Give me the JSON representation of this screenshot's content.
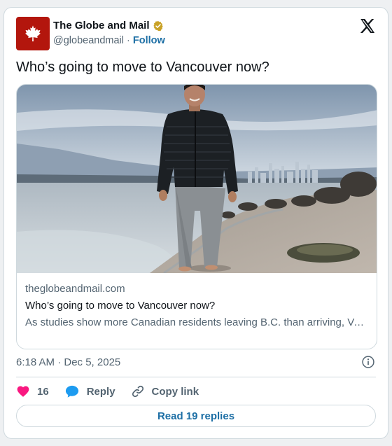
{
  "account": {
    "name": "The Globe and Mail",
    "handle": "@globeandmail",
    "separator": "·",
    "follow_label": "Follow",
    "avatar_icon": "maple-leaf-icon",
    "brand_color": "#b3160d",
    "verified_color": "#c9a227"
  },
  "tweet": {
    "text": "Who’s going to move to Vancouver now?",
    "timestamp": "6:18 AM · Dec 5, 2025"
  },
  "link_card": {
    "image_icon": "photo-man-walking-on-beach",
    "domain": "theglobeandmail.com",
    "title": "Who’s going to move to Vancouver now?",
    "description": "As studies show more Canadian residents leaving B.C. than arriving, Vancouver faces challenges for its tax base and economy directly related to population"
  },
  "actions": {
    "like_count": "16",
    "reply_label": "Reply",
    "copy_link_label": "Copy link",
    "like_color": "#f91880",
    "reply_color": "#1d9bf0"
  },
  "read_replies_label": "Read 19 replies"
}
